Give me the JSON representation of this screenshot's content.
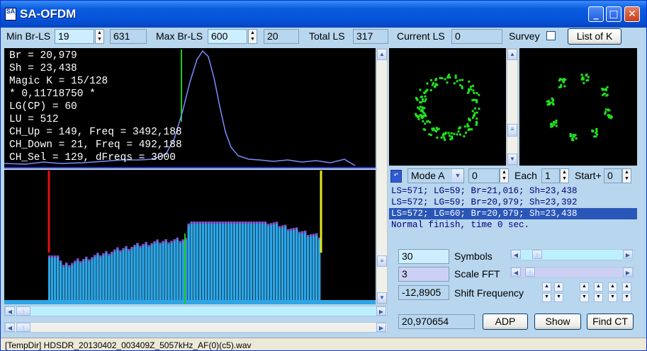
{
  "window": {
    "title": "SA-OFDM",
    "icon_text": "SA"
  },
  "top": {
    "min_brls_label": "Min Br-LS",
    "min_brls_value": "19",
    "min_brls_aux": "631",
    "max_brls_label": "Max Br-LS",
    "max_brls_value": "600",
    "max_brls_aux": "20",
    "total_ls_label": "Total LS",
    "total_ls_value": "317",
    "current_ls_label": "Current LS",
    "current_ls_value": "0",
    "survey_label": "Survey",
    "list_button": "List of K"
  },
  "info_lines": [
    "Br = 20,979",
    "Sh = 23,438",
    "Magic K = 15/128",
    "* 0,11718750 *",
    "LG(CP) = 60",
    "LU = 512",
    "CH_Up = 149, Freq = 3492,188",
    "CH_Down = 21, Freq = 492,188",
    "CH_Sel = 129, dFreqs = 3000"
  ],
  "controls": {
    "mode_value": "Mode A",
    "mode_num": "0",
    "each_label": "Each",
    "each_value": "1",
    "start_label": "Start+",
    "start_value": "0"
  },
  "log": [
    "LS=571; LG=59; Br=21,016; Sh=23,438",
    "LS=572; LG=59; Br=20,979; Sh=23,392",
    "LS=572; LG=60; Br=20,979; Sh=23,438",
    "Normal finish, time 0 sec."
  ],
  "settings": {
    "symbols_value": "30",
    "symbols_label": "Symbols",
    "scale_value": "3",
    "scale_label": "Scale FFT",
    "shift_value": "-12,8905",
    "shift_label": "Shift Frequency",
    "freq_value": "20,970654"
  },
  "buttons": {
    "adp": "ADP",
    "show": "Show",
    "find": "Find CT"
  },
  "status": "[TempDir] HDSDR_20130402_003409Z_5057kHz_AF(0)(c5).wav",
  "colors": {
    "trace": "#7b8cff",
    "bar": "#2ea6e6",
    "bar_top": "#8a4fd0",
    "marker_red": "#e11010",
    "marker_yellow": "#e8e81a",
    "marker_green": "#1fc81f",
    "dots": "#22e022"
  }
}
